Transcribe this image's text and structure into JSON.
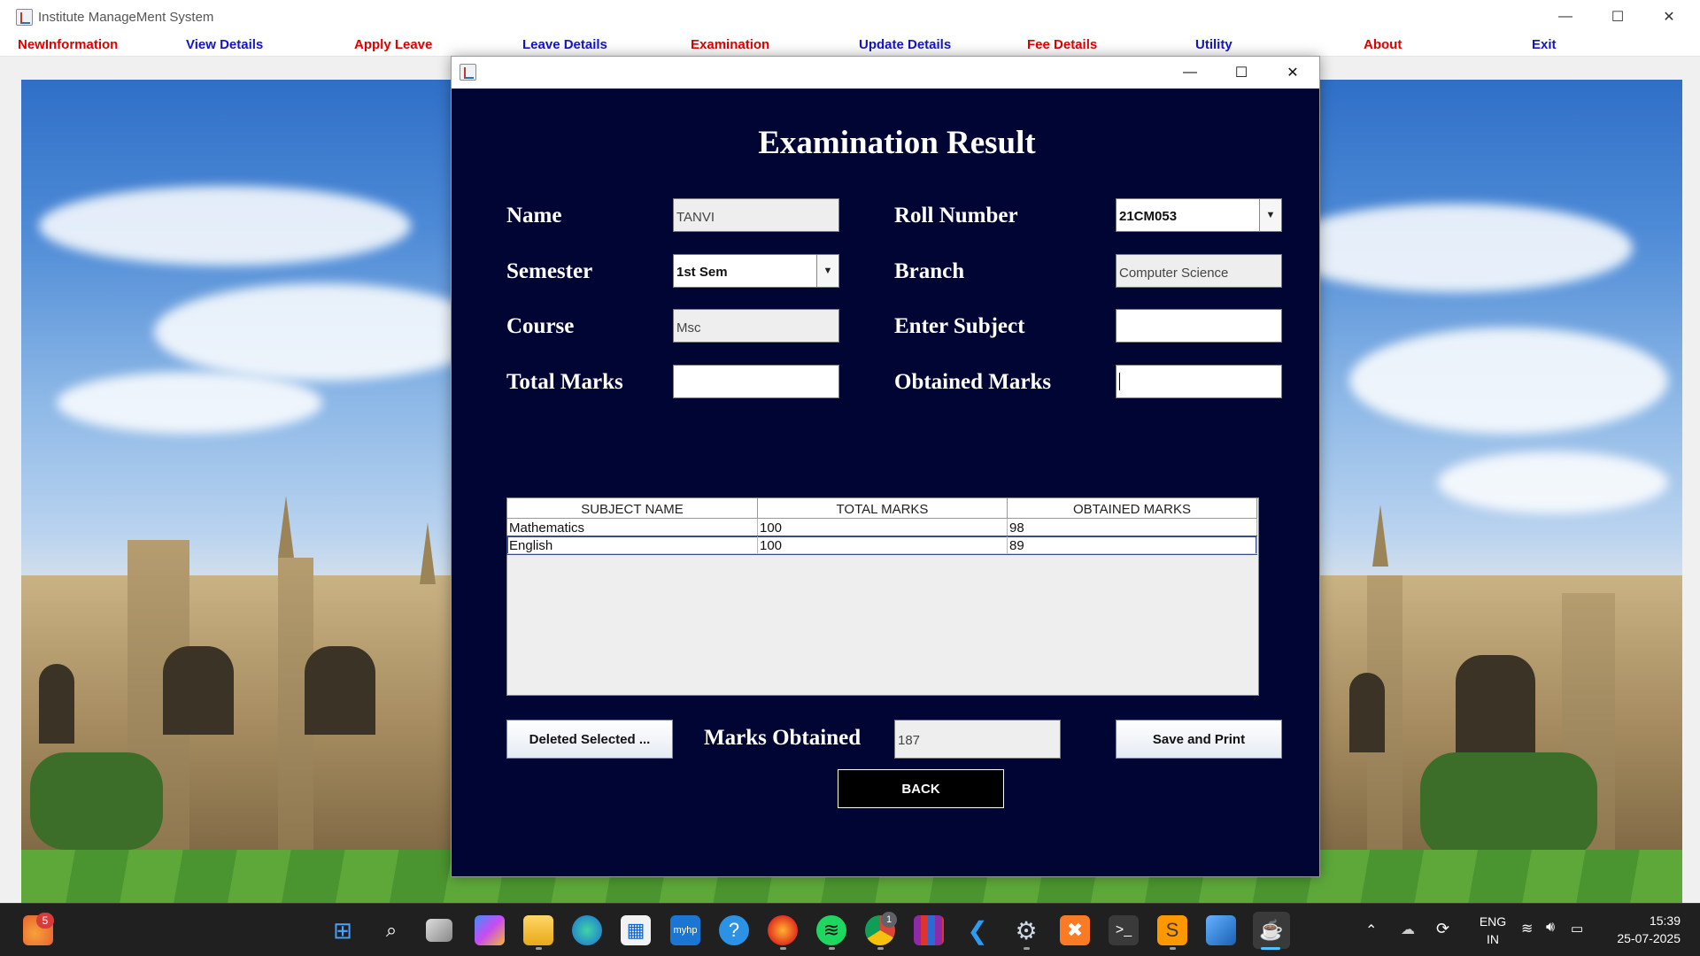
{
  "window": {
    "title": "Institute ManageMent System",
    "minimize": "—",
    "maximize": "☐",
    "close": "✕"
  },
  "menu": [
    {
      "label": "NewInformation",
      "color": "#e00000"
    },
    {
      "label": "View Details",
      "color": "#1414c8"
    },
    {
      "label": "Apply Leave",
      "color": "#e00000"
    },
    {
      "label": "Leave Details",
      "color": "#1414c8"
    },
    {
      "label": "Examination",
      "color": "#e00000"
    },
    {
      "label": "Update Details",
      "color": "#1414c8"
    },
    {
      "label": "Fee Details",
      "color": "#e00000"
    },
    {
      "label": "Utility",
      "color": "#1414c8"
    },
    {
      "label": "About",
      "color": "#e00000"
    },
    {
      "label": "Exit",
      "color": "#1414c8"
    }
  ],
  "dialog": {
    "minimize": "—",
    "maximize": "☐",
    "close": "✕",
    "background": "#010533",
    "heading": "Examination Result",
    "labels": {
      "name": "Name",
      "roll_number": "Roll Number",
      "semester": "Semester",
      "branch": "Branch",
      "course": "Course",
      "enter_subject": "Enter Subject",
      "total_marks": "Total Marks",
      "obtained_marks": "Obtained Marks",
      "marks_obtained": "Marks Obtained"
    },
    "fields": {
      "name": "TANVI",
      "roll_number": "21CM053",
      "semester": "1st Sem",
      "branch": "Computer Science",
      "course": "Msc",
      "enter_subject": "",
      "total_marks": "",
      "obtained_marks": "",
      "marks_obtained": "187"
    },
    "table": {
      "columns": [
        "SUBJECT NAME",
        "TOTAL MARKS",
        "OBTAINED MARKS"
      ],
      "rows": [
        [
          "Mathematics",
          "100",
          "98"
        ],
        [
          "English",
          "100",
          "89"
        ]
      ]
    },
    "buttons": {
      "delete_selected": "Deleted Selected ...",
      "save_print": "Save and Print",
      "back": "BACK"
    }
  },
  "taskbar": {
    "notification_badge": "5",
    "chrome_badge": "1",
    "language": "ENG",
    "region": "IN",
    "time": "15:39",
    "date": "25-07-2025",
    "icons": [
      "start-icon",
      "search-icon",
      "task-view-icon",
      "copilot-icon",
      "file-explorer-icon",
      "edge-icon",
      "store-icon",
      "myhp-icon",
      "help-icon",
      "firefox-icon",
      "spotify-icon",
      "chrome-icon",
      "winrar-icon",
      "vscode-icon",
      "settings-icon",
      "xampp-icon",
      "terminal-icon",
      "sublime-icon",
      "photos-icon",
      "java-icon"
    ]
  }
}
